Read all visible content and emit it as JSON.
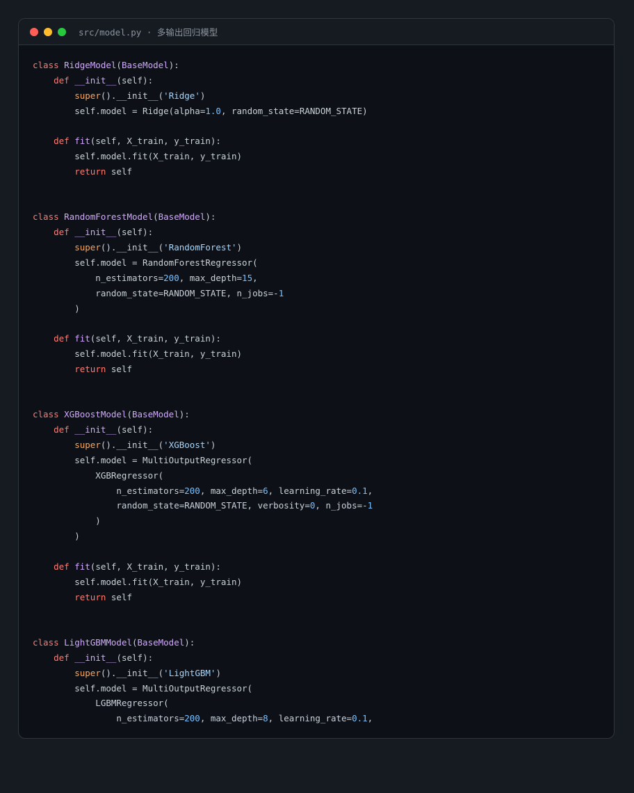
{
  "window": {
    "title": "src/model.py · 多输出回归模型"
  },
  "code_lines": [
    [
      [
        "kw",
        "class "
      ],
      [
        "cls",
        "RidgeModel"
      ],
      [
        "txt",
        "("
      ],
      [
        "cls",
        "BaseModel"
      ],
      [
        "txt",
        "):"
      ]
    ],
    [
      [
        "txt",
        "    "
      ],
      [
        "kw",
        "def "
      ],
      [
        "fn",
        "__init__"
      ],
      [
        "txt",
        "(self):"
      ]
    ],
    [
      [
        "txt",
        "        "
      ],
      [
        "bi",
        "super"
      ],
      [
        "txt",
        "().__init__("
      ],
      [
        "str",
        "'Ridge'"
      ],
      [
        "txt",
        ")"
      ]
    ],
    [
      [
        "txt",
        "        self.model = Ridge(alpha="
      ],
      [
        "num",
        "1.0"
      ],
      [
        "txt",
        ", random_state=RANDOM_STATE)"
      ]
    ],
    [],
    [
      [
        "txt",
        "    "
      ],
      [
        "kw",
        "def "
      ],
      [
        "fn",
        "fit"
      ],
      [
        "txt",
        "(self, X_train, y_train):"
      ]
    ],
    [
      [
        "txt",
        "        self.model.fit(X_train, y_train)"
      ]
    ],
    [
      [
        "txt",
        "        "
      ],
      [
        "kw",
        "return "
      ],
      [
        "txt",
        "self"
      ]
    ],
    [],
    [],
    [
      [
        "kw",
        "class "
      ],
      [
        "cls",
        "RandomForestModel"
      ],
      [
        "txt",
        "("
      ],
      [
        "cls",
        "BaseModel"
      ],
      [
        "txt",
        "):"
      ]
    ],
    [
      [
        "txt",
        "    "
      ],
      [
        "kw",
        "def "
      ],
      [
        "fn",
        "__init__"
      ],
      [
        "txt",
        "(self):"
      ]
    ],
    [
      [
        "txt",
        "        "
      ],
      [
        "bi",
        "super"
      ],
      [
        "txt",
        "().__init__("
      ],
      [
        "str",
        "'RandomForest'"
      ],
      [
        "txt",
        ")"
      ]
    ],
    [
      [
        "txt",
        "        self.model = RandomForestRegressor("
      ]
    ],
    [
      [
        "txt",
        "            n_estimators="
      ],
      [
        "num",
        "200"
      ],
      [
        "txt",
        ", max_depth="
      ],
      [
        "num",
        "15"
      ],
      [
        "txt",
        ","
      ]
    ],
    [
      [
        "txt",
        "            random_state=RANDOM_STATE, n_jobs=-"
      ],
      [
        "num",
        "1"
      ]
    ],
    [
      [
        "txt",
        "        )"
      ]
    ],
    [],
    [
      [
        "txt",
        "    "
      ],
      [
        "kw",
        "def "
      ],
      [
        "fn",
        "fit"
      ],
      [
        "txt",
        "(self, X_train, y_train):"
      ]
    ],
    [
      [
        "txt",
        "        self.model.fit(X_train, y_train)"
      ]
    ],
    [
      [
        "txt",
        "        "
      ],
      [
        "kw",
        "return "
      ],
      [
        "txt",
        "self"
      ]
    ],
    [],
    [],
    [
      [
        "kw",
        "class "
      ],
      [
        "cls",
        "XGBoostModel"
      ],
      [
        "txt",
        "("
      ],
      [
        "cls",
        "BaseModel"
      ],
      [
        "txt",
        "):"
      ]
    ],
    [
      [
        "txt",
        "    "
      ],
      [
        "kw",
        "def "
      ],
      [
        "fn",
        "__init__"
      ],
      [
        "txt",
        "(self):"
      ]
    ],
    [
      [
        "txt",
        "        "
      ],
      [
        "bi",
        "super"
      ],
      [
        "txt",
        "().__init__("
      ],
      [
        "str",
        "'XGBoost'"
      ],
      [
        "txt",
        ")"
      ]
    ],
    [
      [
        "txt",
        "        self.model = MultiOutputRegressor("
      ]
    ],
    [
      [
        "txt",
        "            XGBRegressor("
      ]
    ],
    [
      [
        "txt",
        "                n_estimators="
      ],
      [
        "num",
        "200"
      ],
      [
        "txt",
        ", max_depth="
      ],
      [
        "num",
        "6"
      ],
      [
        "txt",
        ", learning_rate="
      ],
      [
        "num",
        "0.1"
      ],
      [
        "txt",
        ","
      ]
    ],
    [
      [
        "txt",
        "                random_state=RANDOM_STATE, verbosity="
      ],
      [
        "num",
        "0"
      ],
      [
        "txt",
        ", n_jobs=-"
      ],
      [
        "num",
        "1"
      ]
    ],
    [
      [
        "txt",
        "            )"
      ]
    ],
    [
      [
        "txt",
        "        )"
      ]
    ],
    [],
    [
      [
        "txt",
        "    "
      ],
      [
        "kw",
        "def "
      ],
      [
        "fn",
        "fit"
      ],
      [
        "txt",
        "(self, X_train, y_train):"
      ]
    ],
    [
      [
        "txt",
        "        self.model.fit(X_train, y_train)"
      ]
    ],
    [
      [
        "txt",
        "        "
      ],
      [
        "kw",
        "return "
      ],
      [
        "txt",
        "self"
      ]
    ],
    [],
    [],
    [
      [
        "kw",
        "class "
      ],
      [
        "cls",
        "LightGBMModel"
      ],
      [
        "txt",
        "("
      ],
      [
        "cls",
        "BaseModel"
      ],
      [
        "txt",
        "):"
      ]
    ],
    [
      [
        "txt",
        "    "
      ],
      [
        "kw",
        "def "
      ],
      [
        "fn",
        "__init__"
      ],
      [
        "txt",
        "(self):"
      ]
    ],
    [
      [
        "txt",
        "        "
      ],
      [
        "bi",
        "super"
      ],
      [
        "txt",
        "().__init__("
      ],
      [
        "str",
        "'LightGBM'"
      ],
      [
        "txt",
        ")"
      ]
    ],
    [
      [
        "txt",
        "        self.model = MultiOutputRegressor("
      ]
    ],
    [
      [
        "txt",
        "            LGBMRegressor("
      ]
    ],
    [
      [
        "txt",
        "                n_estimators="
      ],
      [
        "num",
        "200"
      ],
      [
        "txt",
        ", max_depth="
      ],
      [
        "num",
        "8"
      ],
      [
        "txt",
        ", learning_rate="
      ],
      [
        "num",
        "0.1"
      ],
      [
        "txt",
        ","
      ]
    ]
  ],
  "colors": {
    "keyword": "#ff7b72",
    "class_name": "#d2a8ff",
    "builtin": "#ffa657",
    "string": "#a5d6ff",
    "number": "#79c0ff",
    "text": "#c9d1d9",
    "window_bg": "#0d1117",
    "page_bg": "#161b22"
  }
}
